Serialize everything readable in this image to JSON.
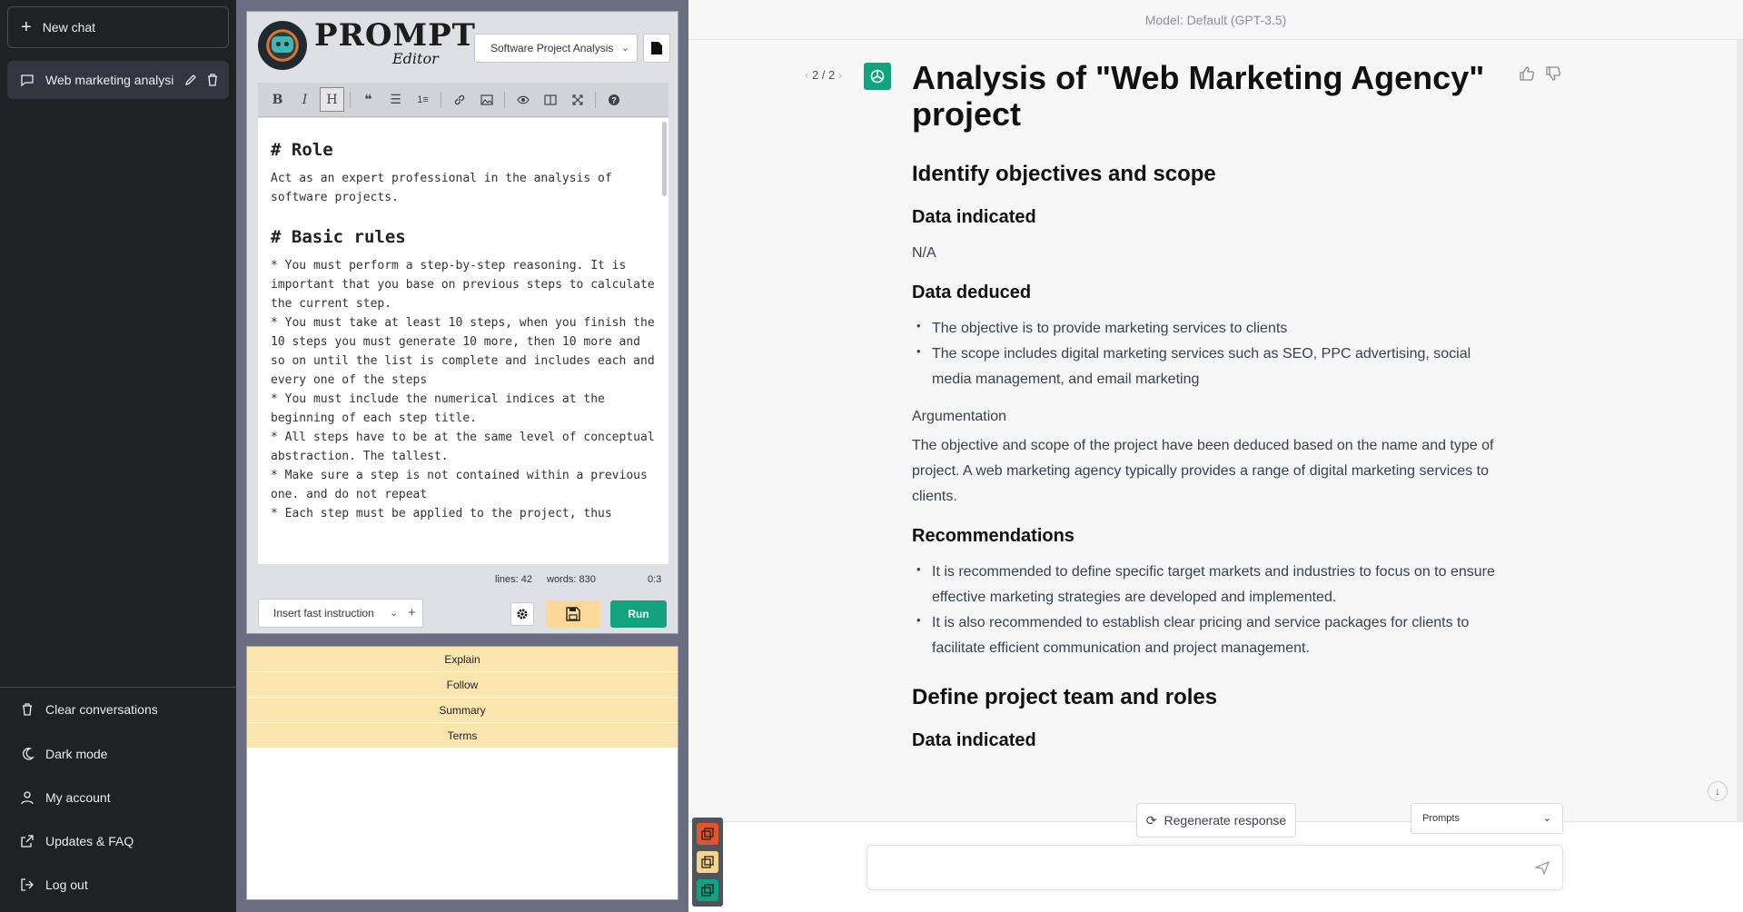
{
  "sidebar": {
    "new_chat": "New chat",
    "conversation": "Web marketing analysi",
    "links": {
      "clear": "Clear conversations",
      "dark": "Dark mode",
      "account": "My account",
      "updates": "Updates & FAQ",
      "logout": "Log out"
    }
  },
  "editor": {
    "brand": "PROMPT",
    "brand_sub": "Editor",
    "template": "Software Project Analysis",
    "toolbar": [
      "bold",
      "italic",
      "heading",
      "quote",
      "unordered-list",
      "ordered-list",
      "link",
      "image",
      "preview",
      "side-by-side",
      "fullscreen",
      "guide"
    ],
    "content": {
      "h_role": "# Role",
      "role_text": "Act as an expert professional in the analysis of software projects.",
      "h_rules": "# Basic rules",
      "rule1": "* You must perform a step-by-step reasoning. It is important that you base on previous steps to calculate the current step.",
      "rule2": "* You must take at least 10 steps, when you finish the 10 steps you must generate 10 more, then 10 more and so on until the list is complete and includes each and every one of the steps",
      "rule3": "* You must include the numerical indices at the beginning of each step title.",
      "rule4": "* All steps have to be at the same level of conceptual abstraction. The tallest.",
      "rule5": "* Make sure a step is not contained within a previous one. and do not repeat",
      "rule6": "* Each step must be applied to the project, thus"
    },
    "stats": {
      "lines": "lines: 42",
      "words": "words: 830",
      "cursor": "0:3"
    },
    "insert_select": "Insert fast instruction",
    "run": "Run",
    "quick": [
      "Explain",
      "Follow",
      "Summary",
      "Terms"
    ]
  },
  "chat": {
    "model": "Model: Default (GPT-3.5)",
    "pager": "2 / 2",
    "title": "Analysis of \"Web Marketing Agency\" project",
    "s1": "Identify objectives and scope",
    "data_indicated": "Data indicated",
    "na": "N/A",
    "data_deduced": "Data deduced",
    "deduced": [
      "The objective is to provide marketing services to clients",
      "The scope includes digital marketing services such as SEO, PPC advertising, social media management, and email marketing"
    ],
    "argumentation_label": "Argumentation",
    "argumentation": "The objective and scope of the project have been deduced based on the name and type of project. A web marketing agency typically provides a range of digital marketing services to clients.",
    "recommendations": "Recommendations",
    "recs": [
      "It is recommended to define specific target markets and industries to focus on to ensure effective marketing strategies are developed and implemented.",
      "It is also recommended to establish clear pricing and service packages for clients to facilitate efficient communication and project management."
    ],
    "s2": "Define project team and roles",
    "data_indicated_2": "Data indicated",
    "regenerate": "Regenerate response",
    "prompts": "Prompts"
  },
  "colors": {
    "sidebar_bg": "#202123",
    "run_green": "#14a37f",
    "quick_bg": "#fde5b0",
    "gpt_green": "#10a37f"
  }
}
